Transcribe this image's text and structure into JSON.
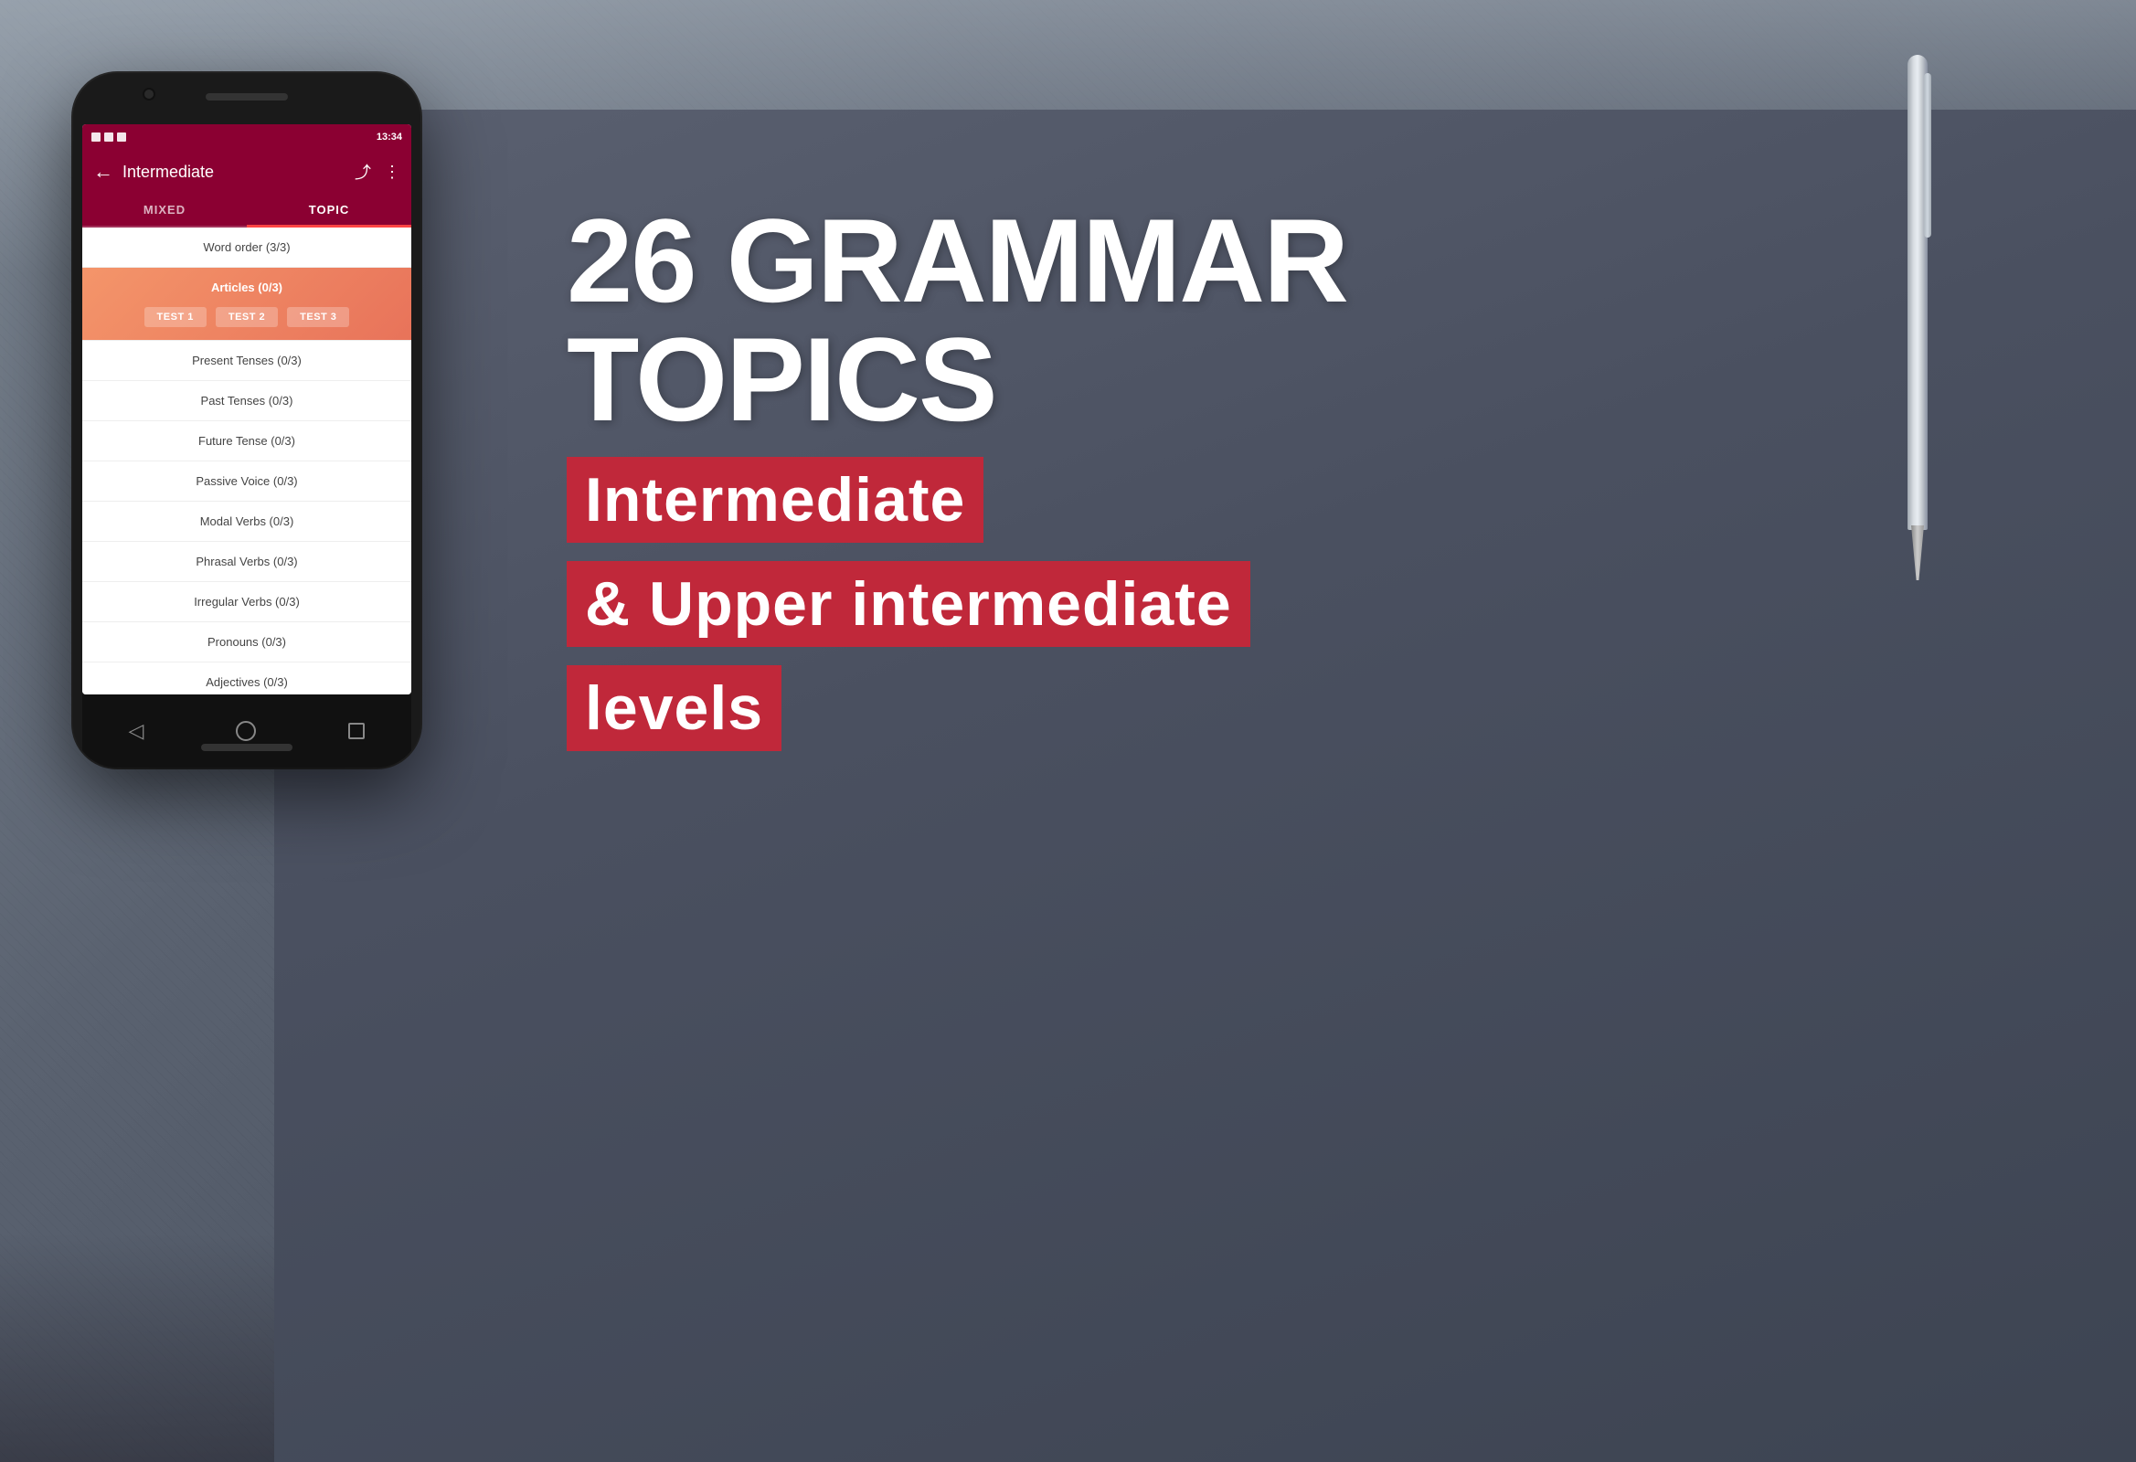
{
  "background": {
    "color": "#6b7280"
  },
  "right_content": {
    "grammar_line1": "26 GRAMMAR",
    "grammar_line2": "TOPICS",
    "level_line1": "Intermediate",
    "level_line2": "& Upper intermediate",
    "level_line3": "levels"
  },
  "phone": {
    "status_bar": {
      "time": "13:34"
    },
    "toolbar": {
      "back_icon": "←",
      "title": "Intermediate",
      "share_icon": "⤴",
      "more_icon": "⋮"
    },
    "tabs": [
      {
        "label": "MIXED",
        "active": false
      },
      {
        "label": "TOPIC",
        "active": true
      }
    ],
    "list_items": [
      {
        "text": "Word order (3/3)",
        "active": false,
        "tests": []
      },
      {
        "text": "Articles (0/3)",
        "active": true,
        "tests": [
          "TEST 1",
          "TEST 2",
          "TEST 3"
        ]
      },
      {
        "text": "Present Tenses (0/3)",
        "active": false,
        "tests": []
      },
      {
        "text": "Past Tenses (0/3)",
        "active": false,
        "tests": []
      },
      {
        "text": "Future Tense (0/3)",
        "active": false,
        "tests": []
      },
      {
        "text": "Passive Voice (0/3)",
        "active": false,
        "tests": []
      },
      {
        "text": "Modal Verbs (0/3)",
        "active": false,
        "tests": []
      },
      {
        "text": "Phrasal Verbs (0/3)",
        "active": false,
        "tests": []
      },
      {
        "text": "Irregular Verbs (0/3)",
        "active": false,
        "tests": []
      },
      {
        "text": "Pronouns (0/3)",
        "active": false,
        "tests": []
      },
      {
        "text": "Adjectives (0/3)",
        "active": false,
        "tests": []
      }
    ],
    "nav": {
      "back": "◁",
      "home": "○",
      "recent": "□"
    }
  }
}
